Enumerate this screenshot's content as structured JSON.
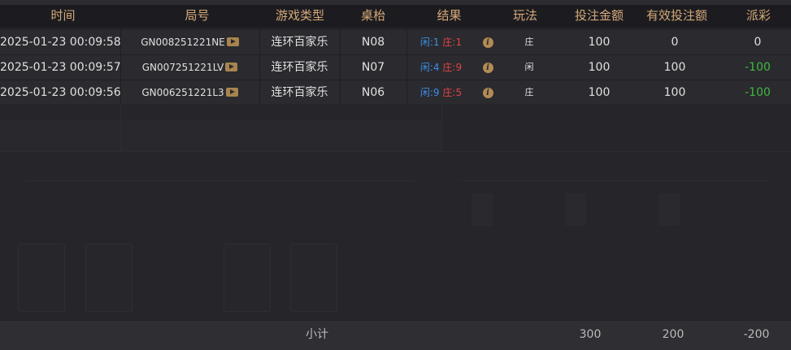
{
  "columns": [
    "时间",
    "局号",
    "游戏类型",
    "桌枱",
    "结果",
    "玩法",
    "投注金额",
    "有效投注额",
    "派彩"
  ],
  "rows": [
    {
      "time": "2025-01-23 00:09:58",
      "round": "GN008251221NE",
      "game": "连环百家乐",
      "table": "N08",
      "player_label": "闲",
      "player_val": ":1",
      "banker_label": "庄",
      "banker_val": ":1",
      "play": "庄",
      "bet": "100",
      "valid": "0",
      "payout": "0"
    },
    {
      "time": "2025-01-23 00:09:57",
      "round": "GN007251221LV",
      "game": "连环百家乐",
      "table": "N07",
      "player_label": "闲",
      "player_val": ":4",
      "banker_label": "庄",
      "banker_val": ":9",
      "play": "闲",
      "bet": "100",
      "valid": "100",
      "payout": "-100"
    },
    {
      "time": "2025-01-23 00:09:56",
      "round": "GN006251221L3",
      "game": "连环百家乐",
      "table": "N06",
      "player_label": "闲",
      "player_val": ":9",
      "banker_label": "庄",
      "banker_val": ":5",
      "play": "庄",
      "bet": "100",
      "valid": "100",
      "payout": "-100"
    }
  ],
  "footer": {
    "label": "小计",
    "bet_total": "300",
    "valid_total": "200",
    "payout_total": "-200"
  },
  "icons": {
    "video": "play-video-icon",
    "detail": "info-icon"
  },
  "colors": {
    "header_text": "#d5a978",
    "player": "#3d8fe6",
    "banker": "#e04545",
    "loss": "#3fb83f"
  }
}
